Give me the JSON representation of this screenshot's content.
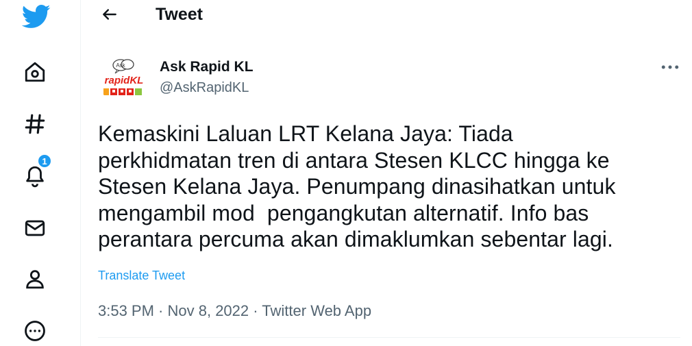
{
  "sidebar": {
    "items": [
      {
        "icon": "twitter-logo-icon"
      },
      {
        "icon": "home-icon"
      },
      {
        "icon": "hashtag-icon"
      },
      {
        "icon": "bell-icon",
        "badge": "1"
      },
      {
        "icon": "mail-icon"
      },
      {
        "icon": "profile-icon"
      },
      {
        "icon": "more-circle-icon"
      }
    ]
  },
  "header": {
    "back_icon": "arrow-left-icon",
    "title": "Tweet"
  },
  "tweet": {
    "author_name": "Ask Rapid KL",
    "author_handle": "@AskRapidKL",
    "avatar": {
      "bubble_text": "Ask",
      "brand_text": "rapidKL"
    },
    "more_icon": "ellipsis-icon",
    "text": "Kemaskini Laluan LRT Kelana Jaya: Tiada\nperkhidmatan tren di antara Stesen KLCC hingga ke\nStesen Kelana Jaya. Penumpang dinasihatkan untuk\nmengambil mod  pengangkutan alternatif. Info bas\nperantara percuma akan dimaklumkan sebentar lagi.",
    "translate_label": "Translate Tweet",
    "time": "3:53 PM",
    "date": "Nov 8, 2022",
    "source": "Twitter Web App",
    "separator": " · "
  },
  "colors": {
    "accent": "#1d9bf0",
    "text": "#0f1419",
    "muted": "#536471",
    "border": "#eff3f4",
    "brand_red": "#e2231a"
  }
}
